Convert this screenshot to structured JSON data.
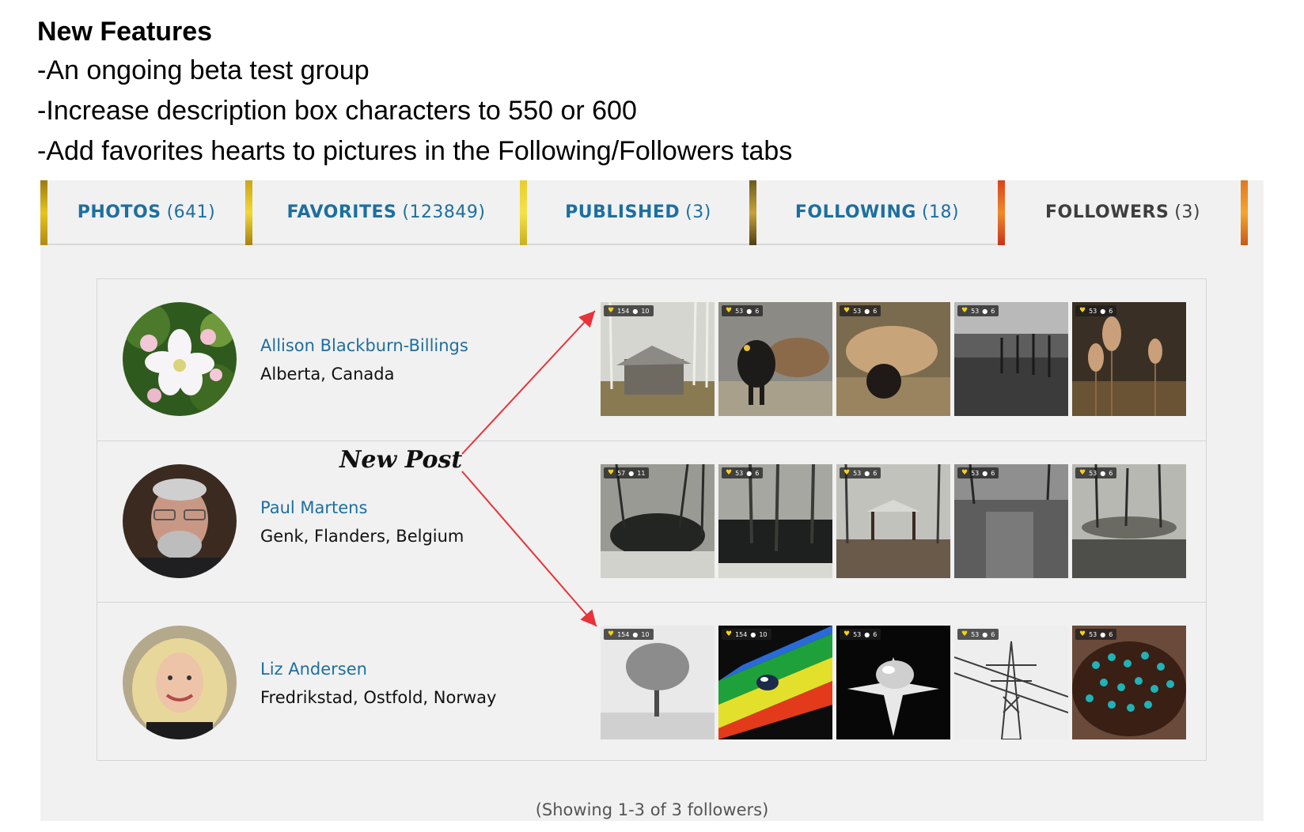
{
  "notes": {
    "title": "New Features",
    "items": [
      "-An ongoing beta test group",
      "-Increase description box characters to 550 or 600",
      "-Add favorites hearts to pictures in the Following/Followers tabs"
    ]
  },
  "tabs": [
    {
      "label": "PHOTOS",
      "count": "(641)"
    },
    {
      "label": "FAVORITES",
      "count": "(123849)"
    },
    {
      "label": "PUBLISHED",
      "count": "(3)"
    },
    {
      "label": "FOLLOWING",
      "count": "(18)"
    },
    {
      "label": "FOLLOWERS",
      "count": "(3)",
      "active": true
    }
  ],
  "followers": [
    {
      "name": "Allison Blackburn-Billings",
      "location": "Alberta, Canada",
      "photos": [
        {
          "favorites": "154",
          "comments": "10"
        },
        {
          "favorites": "53",
          "comments": "6"
        },
        {
          "favorites": "53",
          "comments": "6"
        },
        {
          "favorites": "53",
          "comments": "6"
        },
        {
          "favorites": "53",
          "comments": "6"
        }
      ]
    },
    {
      "name": "Paul Martens",
      "location": "Genk, Flanders, Belgium",
      "photos": [
        {
          "favorites": "57",
          "comments": "11"
        },
        {
          "favorites": "53",
          "comments": "6"
        },
        {
          "favorites": "53",
          "comments": "6"
        },
        {
          "favorites": "53",
          "comments": "6"
        },
        {
          "favorites": "53",
          "comments": "6"
        }
      ]
    },
    {
      "name": "Liz Andersen",
      "location": "Fredrikstad, Ostfold, Norway",
      "photos": [
        {
          "favorites": "154",
          "comments": "10"
        },
        {
          "favorites": "154",
          "comments": "10"
        },
        {
          "favorites": "53",
          "comments": "6"
        },
        {
          "favorites": "53",
          "comments": "6"
        },
        {
          "favorites": "53",
          "comments": "6"
        }
      ]
    }
  ],
  "annotation": "New Post",
  "showing": "(Showing 1-3 of 3 followers)",
  "icons": {
    "favorite": "heart-icon",
    "comment": "comment-icon"
  },
  "colors": {
    "link": "#1d6f9f",
    "heart": "#f4d11a",
    "arrow": "#e8333a"
  }
}
